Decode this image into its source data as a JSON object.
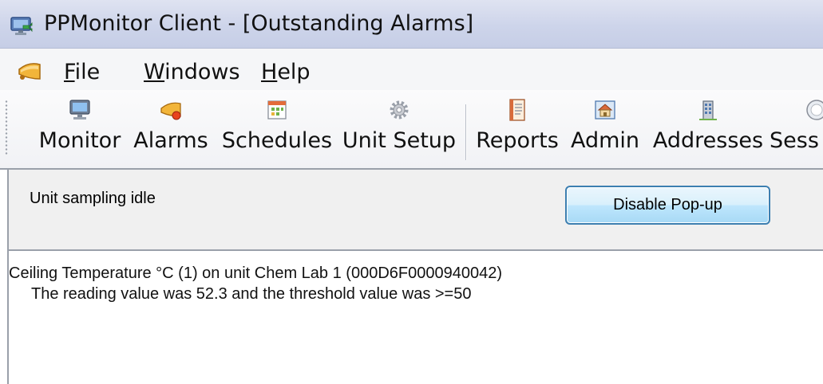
{
  "window": {
    "title": "PPMonitor Client - [Outstanding Alarms]",
    "icon": "monitor-app-icon"
  },
  "menu": {
    "app_icon": "bell-icon",
    "items": [
      {
        "first": "F",
        "rest": "ile"
      },
      {
        "first": "W",
        "rest": "indows"
      },
      {
        "first": "H",
        "rest": "elp"
      }
    ]
  },
  "toolbar": {
    "buttons": [
      {
        "label": "Monitor",
        "icon": "monitor-icon"
      },
      {
        "label": "Alarms",
        "icon": "bell-icon"
      },
      {
        "label": "Schedules",
        "icon": "calendar-icon"
      },
      {
        "label": "Unit Setup",
        "icon": "gear-icon"
      },
      {
        "label": "Reports",
        "icon": "report-icon"
      },
      {
        "label": "Admin",
        "icon": "house-icon"
      },
      {
        "label": "Addresses",
        "icon": "building-icon"
      },
      {
        "label": "Sess",
        "icon": "sessions-icon"
      }
    ]
  },
  "status": {
    "text": "Unit sampling idle",
    "disable_popup_label": "Disable Pop-up"
  },
  "alarm": {
    "line1": "Ceiling Temperature °C (1) on unit Chem Lab 1 (000D6F0000940042)",
    "line2": "The reading value was 52.3 and the threshold value was >=50"
  },
  "colors": {
    "titlebar": "#cdd4ea",
    "button_border": "#3c7fb1",
    "panel_bg": "#f0f0f0"
  }
}
